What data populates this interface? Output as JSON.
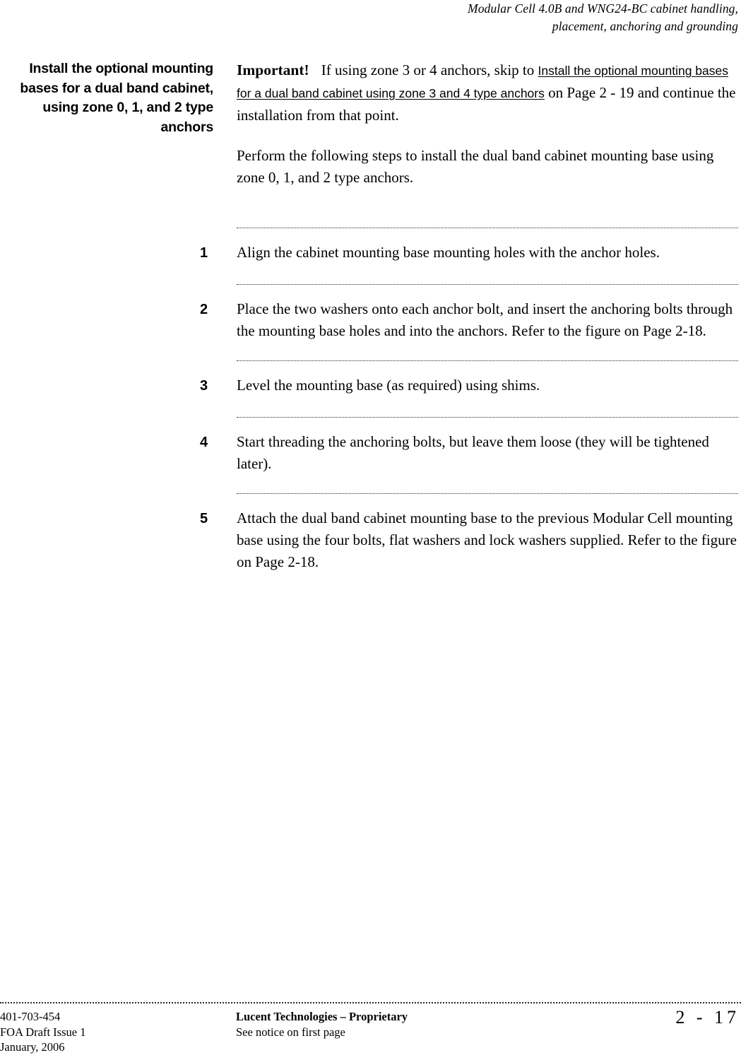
{
  "header": {
    "line1": "Modular Cell 4.0B and WNG24-BC cabinet handling,",
    "line2": "placement, anchoring and grounding"
  },
  "margin_heading": "Install the optional mounting bases for a dual band cabinet, using zone 0, 1, and 2 type anchors",
  "important": {
    "label": "Important!",
    "text_before_link": "If using zone 3 or 4 anchors, skip to ",
    "link_text": "Install the optional mounting bases for a dual band cabinet using zone 3 and 4 type anchors",
    "text_after_link": " on Page 2 - 19 and continue the installation from that point."
  },
  "intro_paragraph": "Perform the following steps to install the dual band cabinet mounting base using zone 0, 1, and 2 type anchors.",
  "steps": [
    {
      "number": "1",
      "text": "Align the cabinet mounting base mounting holes with the anchor holes."
    },
    {
      "number": "2",
      "text": "Place the two washers onto each anchor bolt, and insert the anchoring bolts through the mounting base holes and into the anchors. Refer to the figure on Page 2-18."
    },
    {
      "number": "3",
      "text": "Level the mounting base (as required) using shims."
    },
    {
      "number": "4",
      "text": "Start threading the anchoring bolts, but leave them loose (they will be tightened later)."
    },
    {
      "number": "5",
      "text": "Attach the dual band cabinet mounting base to the previous Modular Cell mounting base using the four bolts, flat washers and lock washers supplied. Refer to the figure on Page 2-18."
    }
  ],
  "footer": {
    "doc_number": "401-703-454",
    "issue": "FOA Draft Issue 1",
    "date": "January, 2006",
    "proprietary_notice": "Lucent Technologies – Proprietary",
    "notice_sub": "See notice on first page",
    "page_number": "2 - 17"
  }
}
